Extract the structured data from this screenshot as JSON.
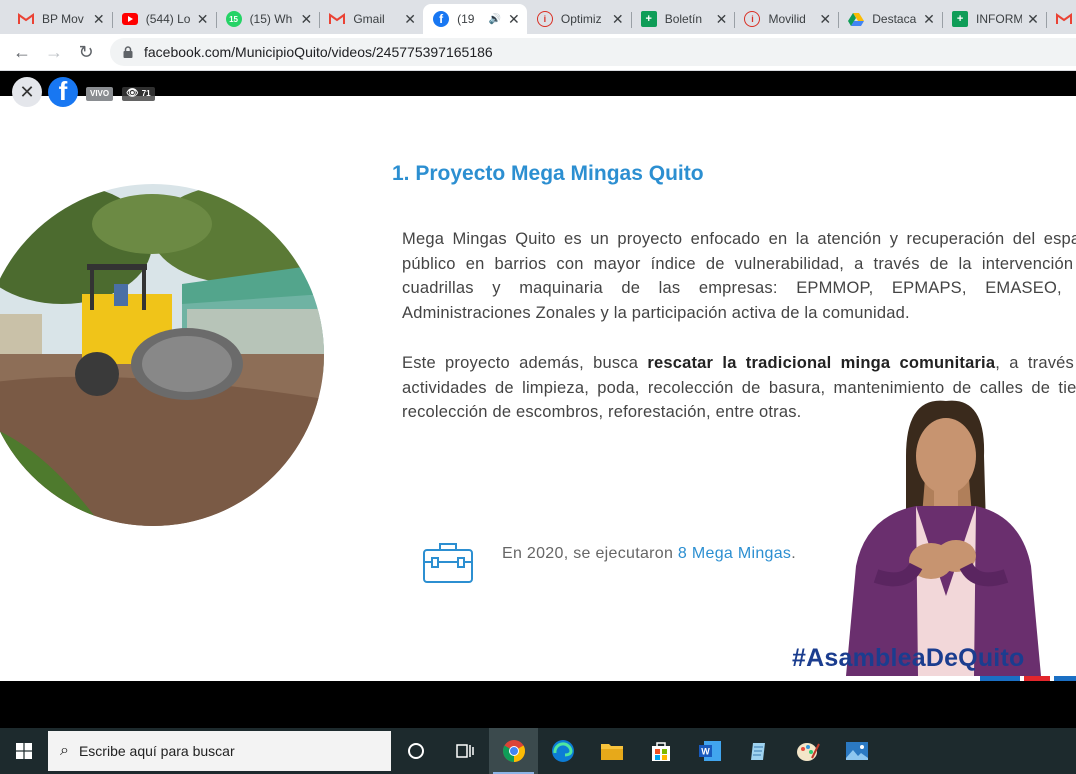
{
  "browser": {
    "tabs": [
      {
        "label": "BP Mov",
        "icon": "gmail-icon"
      },
      {
        "label": "(544) Lo",
        "icon": "youtube-icon"
      },
      {
        "label": "(15) Wh",
        "icon": "whatsapp-icon"
      },
      {
        "label": "Gmail",
        "icon": "gmail-icon"
      },
      {
        "label": "(19",
        "icon": "facebook-icon",
        "active": true
      },
      {
        "label": "Optimiz",
        "icon": "alert-icon"
      },
      {
        "label": "Boletín",
        "icon": "sheets-icon"
      },
      {
        "label": "Movilid",
        "icon": "alert-icon"
      },
      {
        "label": "Destaca",
        "icon": "drive-icon"
      },
      {
        "label": "INFORM",
        "icon": "sheets-icon"
      }
    ],
    "url": "facebook.com/MunicipioQuito/videos/245775397165186"
  },
  "video": {
    "live_badge": "VIVO",
    "viewer_count": "71"
  },
  "slide": {
    "title": "1. Proyecto Mega Mingas Quito",
    "paragraph1": "Mega Mingas Quito es un proyecto enfocado en la atención y recuperación del espacio público en barrios con mayor índice de vulnerabilidad, a través de la intervención de cuadrillas y maquinaria de las empresas: EPMMOP, EPMAPS, EMASEO, las Administraciones Zonales y la participación activa de la comunidad.",
    "paragraph2_pre": "Este proyecto además, busca ",
    "paragraph2_bold": "rescatar la tradicional minga comunitaria",
    "paragraph2_post": ", a través de actividades de limpieza, poda, recolección de basura, mantenimiento de calles de tierra, recolección de escombros, reforestación, entre otras.",
    "stat_pre": "En 2020, se ejecutaron ",
    "stat_highlight": "8 Mega Mingas",
    "stat_post": ".",
    "hashtag": "#AsambleaDeQuito"
  },
  "taskbar": {
    "search_placeholder": "Escribe aquí para buscar",
    "apps": [
      "cortana-icon",
      "task-view-icon",
      "chrome-icon",
      "edge-icon",
      "file-explorer-icon",
      "store-icon",
      "word-icon",
      "notepad-icon",
      "paint-icon",
      "photos-icon"
    ]
  },
  "colors": {
    "accent_blue": "#2c8fd1",
    "hashtag_navy": "#1b3d8f",
    "facebook_blue": "#1877f2"
  }
}
